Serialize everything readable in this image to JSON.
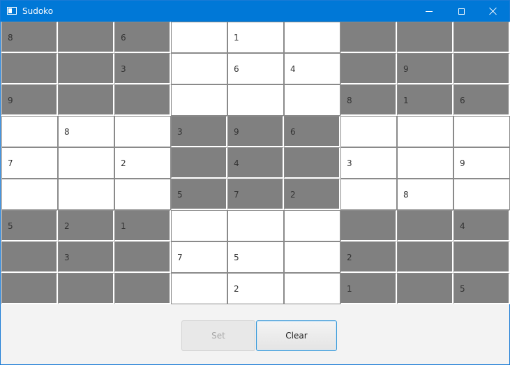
{
  "window": {
    "title": "Sudoko"
  },
  "board": {
    "rows": [
      [
        "8",
        "",
        "6",
        "",
        "1",
        "",
        "",
        "",
        ""
      ],
      [
        "",
        "",
        "3",
        "",
        "6",
        "4",
        "",
        "9",
        ""
      ],
      [
        "9",
        "",
        "",
        "",
        "",
        "",
        "8",
        "1",
        "6"
      ],
      [
        "",
        "8",
        "",
        "3",
        "9",
        "6",
        "",
        "",
        ""
      ],
      [
        "7",
        "",
        "2",
        "",
        "4",
        "",
        "3",
        "",
        "9"
      ],
      [
        "",
        "",
        "",
        "5",
        "7",
        "2",
        "",
        "8",
        ""
      ],
      [
        "5",
        "2",
        "1",
        "",
        "",
        "",
        "",
        "",
        "4"
      ],
      [
        "",
        "3",
        "",
        "7",
        "5",
        "",
        "2",
        "",
        ""
      ],
      [
        "",
        "",
        "",
        "",
        "2",
        "",
        "1",
        "",
        "5"
      ]
    ],
    "dark_color": "#808080",
    "light_color": "#ffffff"
  },
  "buttons": {
    "set_label": "Set",
    "clear_label": "Clear"
  },
  "colors": {
    "titlebar": "#0078d7",
    "accent_border": "#3a9ad9"
  }
}
